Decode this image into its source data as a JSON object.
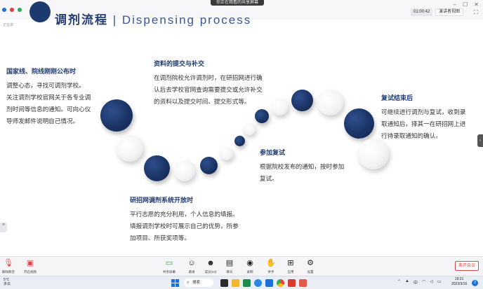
{
  "meeting": {
    "sharing_banner": "你正在观看的共享屏幕",
    "timer": "01:00:42",
    "view_label": "演讲者视图",
    "win_minimize": "–",
    "win_maximize": "☐",
    "win_close": "✕"
  },
  "slide": {
    "title_cn": "调剂流程",
    "title_sep": " | ",
    "title_en": "Dispensing process",
    "presenter_label": "正在讲"
  },
  "steps": [
    {
      "heading": "国家线、院线刚刚公布时",
      "body": [
        "调整心态，寻找可调剂学校。",
        "关注调剂学校官网关于各专业调",
        "剂时间等信息的通知。可向心仪",
        "导师发邮件说明自己情况。"
      ]
    },
    {
      "heading": "资料的提交与补交",
      "body": [
        "在调剂院校允许调剂时，在研招网进行确",
        "认后去学校官网查询需要提交或允许补交",
        "的资料以及提交时间、提交形式等。"
      ]
    },
    {
      "heading": "复试结束后",
      "body": [
        "可继续进行调剂与复试，收到录",
        "取通知后，择其一在研招网上进",
        "行待录取通知的确认。"
      ]
    },
    {
      "heading": "参加复试",
      "body": [
        "根据院校发布的通知，按时参加",
        "复试。"
      ]
    },
    {
      "heading": "研招网调剂系统开放时",
      "body": [
        "平行志愿的充分利用，个人信息的填报。",
        "填报调剂学校时可展示自己的优势，所参",
        "加项目、所获奖项等。"
      ]
    }
  ],
  "toolbar": {
    "mic": {
      "icon": "microphone-muted-icon",
      "label": "解除静音"
    },
    "video": {
      "icon": "camera-off-icon",
      "label": "开启视频"
    },
    "share": {
      "icon": "share-screen-icon",
      "label": "共享屏幕"
    },
    "invite": {
      "icon": "invite-icon",
      "label": "邀请"
    },
    "members": {
      "icon": "members-icon",
      "label": "成员(23)"
    },
    "chat": {
      "icon": "chat-icon",
      "label": "聊天"
    },
    "record": {
      "icon": "record-icon",
      "label": "录制"
    },
    "raise_hand": {
      "icon": "hand-icon",
      "label": "举手"
    },
    "apps": {
      "icon": "apps-icon",
      "label": "应用"
    },
    "settings": {
      "icon": "gear-icon",
      "label": "设置"
    },
    "leave": "离开会议"
  },
  "taskbar": {
    "temperature": "5°C",
    "weather": "多云",
    "search": "搜索",
    "ime": "中",
    "time": "19:31",
    "date": "2023/3/16",
    "notifications": "3"
  },
  "colors": {
    "navy": "#1b3466",
    "title": "#243d73",
    "leave": "#e04848",
    "windows_blue": "#1e6fd9"
  }
}
